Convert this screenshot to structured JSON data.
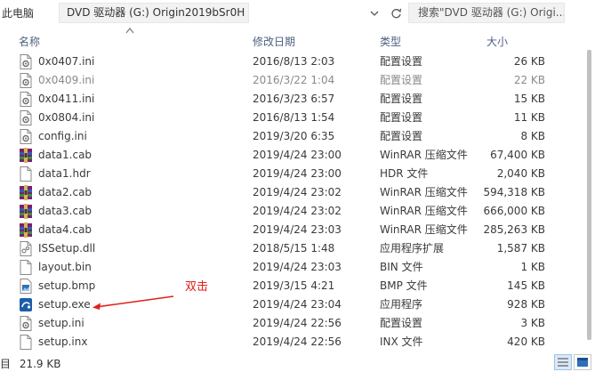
{
  "topbar": {
    "breadcrumb_prev": "此电脑",
    "breadcrumb_current": "DVD 驱动器 (G:) Origin2019bSr0H",
    "dropdown_glyph": "⌄",
    "refresh_glyph": "↻",
    "search_placeholder": "搜索\"DVD 驱动器 (G:) Origi..."
  },
  "columns": {
    "name": "名称",
    "modified": "修改日期",
    "type": "类型",
    "size": "大小"
  },
  "files": [
    {
      "name": "0x0407.ini",
      "modified": "2016/8/13 2:03",
      "type": "配置设置",
      "size": "26 KB",
      "icon": "ini-settings-icon",
      "dim": false
    },
    {
      "name": "0x0409.ini",
      "modified": "2016/3/22 1:04",
      "type": "配置设置",
      "size": "22 KB",
      "icon": "ini-settings-icon",
      "dim": true
    },
    {
      "name": "0x0411.ini",
      "modified": "2016/3/23 6:57",
      "type": "配置设置",
      "size": "15 KB",
      "icon": "ini-settings-icon",
      "dim": false
    },
    {
      "name": "0x0804.ini",
      "modified": "2016/8/13 1:54",
      "type": "配置设置",
      "size": "11 KB",
      "icon": "ini-settings-icon",
      "dim": false
    },
    {
      "name": "config.ini",
      "modified": "2019/3/20 6:35",
      "type": "配置设置",
      "size": "8 KB",
      "icon": "ini-settings-icon",
      "dim": false
    },
    {
      "name": "data1.cab",
      "modified": "2019/4/24 23:00",
      "type": "WinRAR 压缩文件",
      "size": "67,400 KB",
      "icon": "winrar-archive-icon",
      "dim": false
    },
    {
      "name": "data1.hdr",
      "modified": "2019/4/24 23:00",
      "type": "HDR 文件",
      "size": "2,040 KB",
      "icon": "blank-file-icon",
      "dim": false
    },
    {
      "name": "data2.cab",
      "modified": "2019/4/24 23:02",
      "type": "WinRAR 压缩文件",
      "size": "594,318 KB",
      "icon": "winrar-archive-icon",
      "dim": false
    },
    {
      "name": "data3.cab",
      "modified": "2019/4/24 23:02",
      "type": "WinRAR 压缩文件",
      "size": "666,000 KB",
      "icon": "winrar-archive-icon",
      "dim": false
    },
    {
      "name": "data4.cab",
      "modified": "2019/4/24 23:03",
      "type": "WinRAR 压缩文件",
      "size": "285,263 KB",
      "icon": "winrar-archive-icon",
      "dim": false
    },
    {
      "name": "ISSetup.dll",
      "modified": "2018/5/15 1:48",
      "type": "应用程序扩展",
      "size": "1,587 KB",
      "icon": "dll-file-icon",
      "dim": false
    },
    {
      "name": "layout.bin",
      "modified": "2019/4/24 23:03",
      "type": "BIN 文件",
      "size": "1 KB",
      "icon": "blank-file-icon",
      "dim": false
    },
    {
      "name": "setup.bmp",
      "modified": "2019/3/15 4:21",
      "type": "BMP 文件",
      "size": "145 KB",
      "icon": "bmp-image-icon",
      "dim": false
    },
    {
      "name": "setup.exe",
      "modified": "2019/4/24 23:04",
      "type": "应用程序",
      "size": "928 KB",
      "icon": "setup-exe-icon",
      "dim": false
    },
    {
      "name": "setup.ini",
      "modified": "2019/4/24 22:56",
      "type": "配置设置",
      "size": "3 KB",
      "icon": "ini-settings-icon",
      "dim": false
    },
    {
      "name": "setup.inx",
      "modified": "2019/4/24 22:56",
      "type": "INX 文件",
      "size": "420 KB",
      "icon": "blank-file-icon",
      "dim": false
    }
  ],
  "annotation": {
    "text": "双击",
    "color": "#e0201a"
  },
  "statusbar": {
    "glyph": "目",
    "size_text": "21.9 KB"
  },
  "colors": {
    "header_text": "#4d6082",
    "dim_text": "#8a8a8a",
    "winrar_red": "#b0202a",
    "exe_blue": "#1b5ea8"
  }
}
